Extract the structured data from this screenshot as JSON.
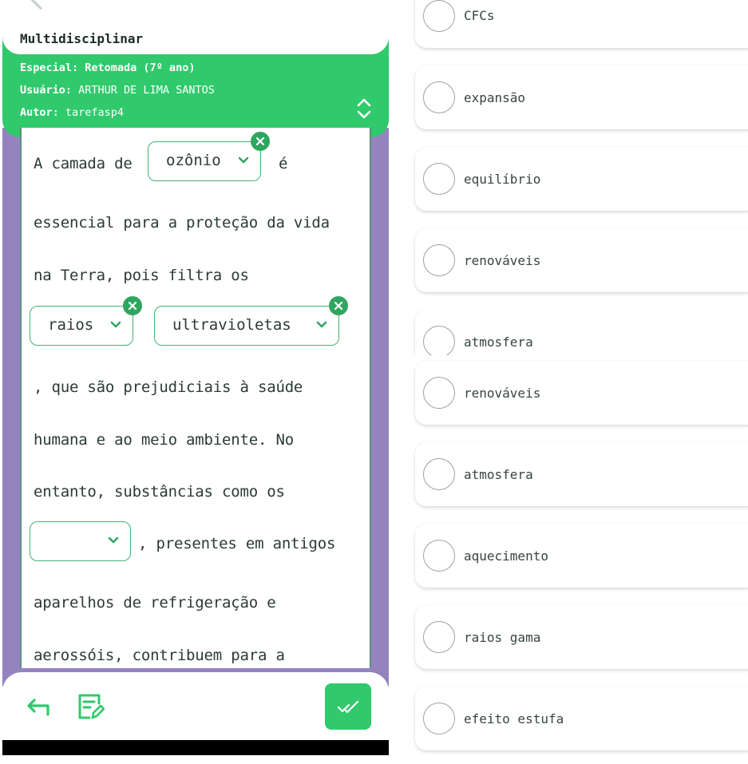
{
  "header": {
    "title": "Multidisciplinar",
    "especial": "Especial: Retomada (7º ano)",
    "usuario_key": "Usuário:",
    "usuario_val": " ARTHUR DE LIMA SANTOS",
    "autor_key": "Autor:",
    "autor_val": " tarefasp4"
  },
  "passage": {
    "t1": "A camada de",
    "t2": "é",
    "t3": "essencial para a proteção da vida",
    "t4": "na Terra, pois filtra os",
    "t5": ", que são prejudiciais à saúde",
    "t6": "humana e ao meio ambiente. No",
    "t7": "entanto, substâncias como os",
    "t8": ", presentes em antigos",
    "t9": "aparelhos de refrigeração e",
    "t10": "aerossóis, contribuem para a"
  },
  "blanks": {
    "b1": "ozônio",
    "b2": "raios",
    "b3": "ultravioletas",
    "b4": ""
  },
  "options_upper": [
    "CFCs",
    "expansão",
    "equilíbrio",
    "renováveis",
    "atmosfera"
  ],
  "options_lower": [
    "renováveis",
    "atmosfera",
    "aquecimento",
    "raios gama",
    "efeito estufa"
  ],
  "icons": {
    "expand": "chevron-up-down-icon",
    "back": "arrow-return-icon",
    "edit": "edit-list-icon",
    "submit": "double-check-icon",
    "remove": "close-circle-icon",
    "dropdown": "chevron-down-icon"
  },
  "colors": {
    "accent_green": "#30c96c",
    "dark_green": "#2fa65f",
    "purple": "#9583c0",
    "text": "#2b3a38"
  }
}
